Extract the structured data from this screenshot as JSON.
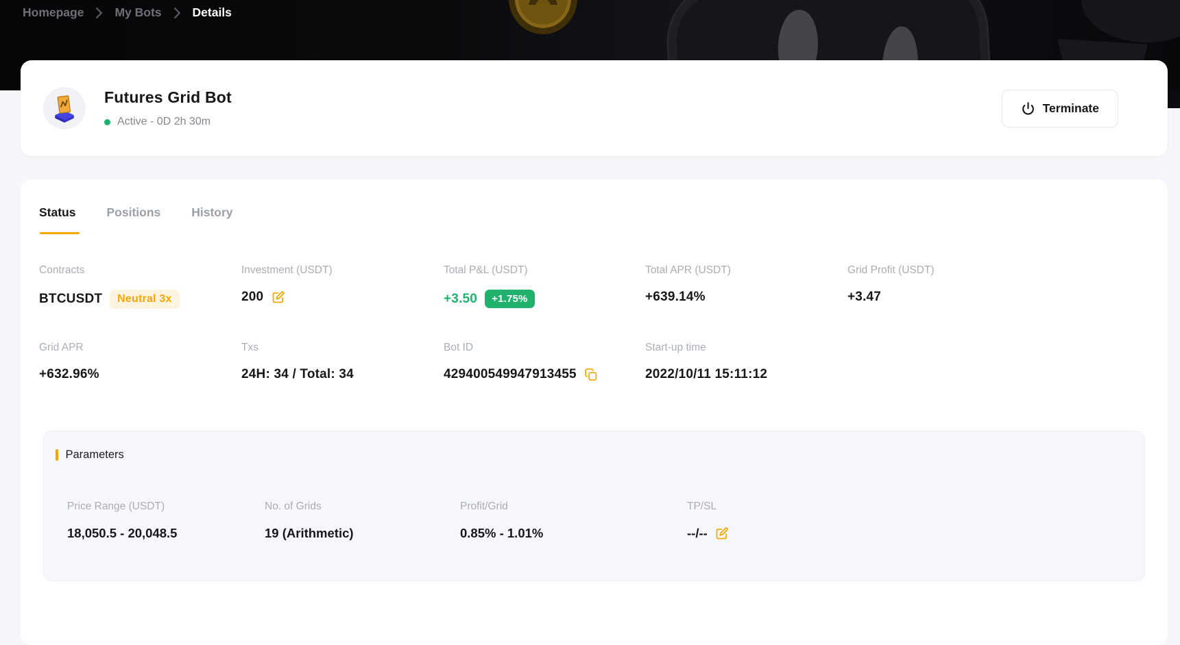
{
  "colors": {
    "accent_orange": "#f7a600",
    "positive_green": "#20b26c",
    "banner_background": "#0b0c0e",
    "page_background": "#f4f6f9",
    "label_gray": "#a9aeb6"
  },
  "breadcrumb": {
    "items": [
      "Homepage",
      "My Bots",
      "Details"
    ],
    "separator_icon": "chevron-right-icon",
    "active": "Details"
  },
  "header": {
    "bot_icon": "futures-grid-bot-3d-icon",
    "title": "Futures Grid Bot",
    "status_dot": "green-dot",
    "status_text": "Active - 0D 2h 30m",
    "terminate": {
      "icon": "power-icon",
      "label": "Terminate"
    }
  },
  "tabs": [
    {
      "label": "Status",
      "active": true
    },
    {
      "label": "Positions",
      "active": false
    },
    {
      "label": "History",
      "active": false
    }
  ],
  "stats": {
    "row1": [
      {
        "label": "Contracts",
        "value": "BTCUSDT",
        "badge": "Neutral 3x"
      },
      {
        "label": "Investment (USDT)",
        "value": "200",
        "edit_icon": "edit-square-icon"
      },
      {
        "label": "Total P&L (USDT)",
        "value": "+3.50",
        "badge": "+1.75%"
      },
      {
        "label": "Total APR (USDT)",
        "value": "+639.14%"
      },
      {
        "label": "Grid Profit (USDT)",
        "value": "+3.47"
      }
    ],
    "row2": [
      {
        "label": "Grid APR",
        "value": "+632.96%"
      },
      {
        "label": "Txs",
        "value": "24H: 34 / Total: 34"
      },
      {
        "label": "Bot ID",
        "value": "429400549947913455",
        "copy_icon": "copy-icon"
      },
      {
        "label": "Start-up time",
        "value": "2022/10/11 15:11:12"
      }
    ]
  },
  "parameters": {
    "title": "Parameters",
    "items": [
      {
        "label": "Price Range (USDT)",
        "value": "18,050.5 - 20,048.5"
      },
      {
        "label": "No. of Grids",
        "value": "19 (Arithmetic)"
      },
      {
        "label": "Profit/Grid",
        "value": "0.85% - 1.01%"
      },
      {
        "label": "TP/SL",
        "value": "--/--",
        "edit_icon": "edit-square-icon"
      }
    ]
  }
}
